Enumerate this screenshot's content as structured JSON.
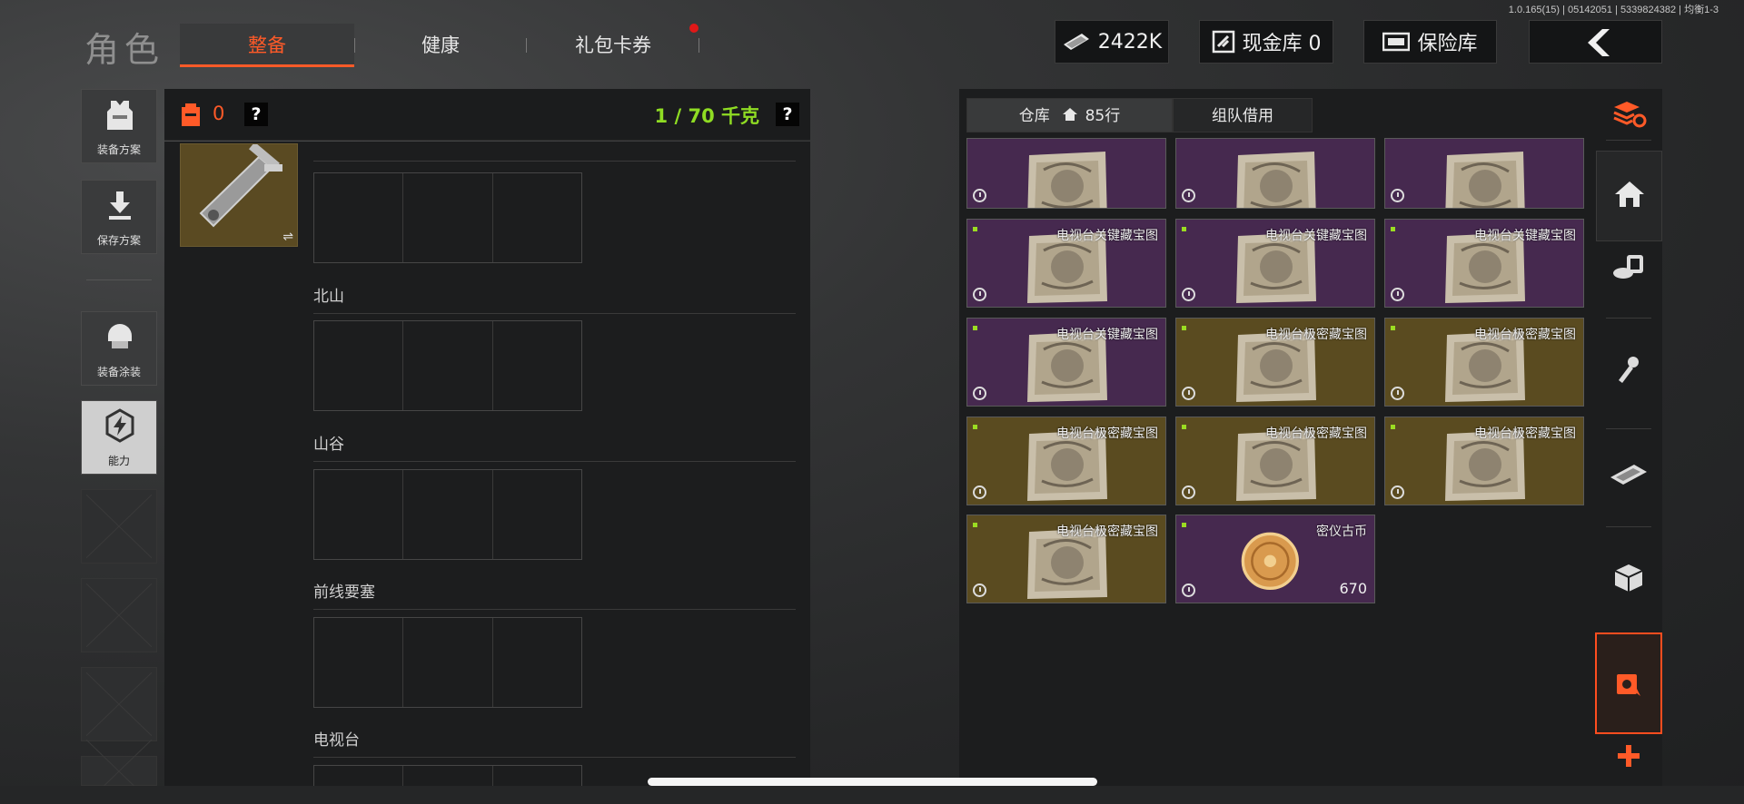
{
  "version_text": "1.0.165(15) | 05142051 | 5339824382 | 均衡1-3",
  "header": {
    "title": "角色",
    "tabs": [
      {
        "label": "整备",
        "active": true
      },
      {
        "label": "健康",
        "active": false
      },
      {
        "label": "礼包卡券",
        "active": false,
        "has_notification": true
      }
    ],
    "currency_value": "2422K",
    "cash_vault_label": "现金库 0",
    "safe_label": "保险库"
  },
  "sidebar": {
    "items": [
      {
        "label": "装备方案",
        "icon": "vest-icon"
      },
      {
        "label": "保存方案",
        "icon": "download-icon"
      },
      {
        "label": "装备涂装",
        "icon": "helmet-icon"
      },
      {
        "label": "能力",
        "icon": "lightning-hex-icon"
      }
    ]
  },
  "loadout": {
    "backpack_count": "0",
    "help_symbol": "?",
    "weight_text": "1 / 70 千克",
    "sections": [
      {
        "label": "北山"
      },
      {
        "label": "山谷"
      },
      {
        "label": "前线要塞"
      },
      {
        "label": "电视台"
      }
    ]
  },
  "storage": {
    "tab_warehouse": "仓库",
    "rows_count": "85行",
    "tab_team": "组队借用",
    "items": [
      {
        "name": "",
        "color": "purple",
        "count": ""
      },
      {
        "name": "",
        "color": "purple",
        "count": ""
      },
      {
        "name": "",
        "color": "purple",
        "count": ""
      },
      {
        "name": "电视台关键藏宝图",
        "color": "purple",
        "count": ""
      },
      {
        "name": "电视台关键藏宝图",
        "color": "purple",
        "count": ""
      },
      {
        "name": "电视台关键藏宝图",
        "color": "purple",
        "count": ""
      },
      {
        "name": "电视台关键藏宝图",
        "color": "purple",
        "count": ""
      },
      {
        "name": "电视台极密藏宝图",
        "color": "gold",
        "count": ""
      },
      {
        "name": "电视台极密藏宝图",
        "color": "gold",
        "count": ""
      },
      {
        "name": "电视台极密藏宝图",
        "color": "gold",
        "count": ""
      },
      {
        "name": "电视台极密藏宝图",
        "color": "gold",
        "count": ""
      },
      {
        "name": "电视台极密藏宝图",
        "color": "gold",
        "count": ""
      },
      {
        "name": "电视台极密藏宝图",
        "color": "gold",
        "count": ""
      },
      {
        "name": "密仪古币",
        "color": "purple",
        "count": "670",
        "type": "coin"
      }
    ]
  },
  "rail_icons": [
    "stack-refresh-icon",
    "home-icon",
    "coins-icon",
    "key-icon",
    "cash-icon",
    "box-icon",
    "safe-icon",
    "plus-icon"
  ],
  "colors": {
    "accent": "#ff5a28",
    "weight_green": "#8fdc23",
    "purple_rarity": "#46294f",
    "gold_rarity": "#5a4b20"
  }
}
